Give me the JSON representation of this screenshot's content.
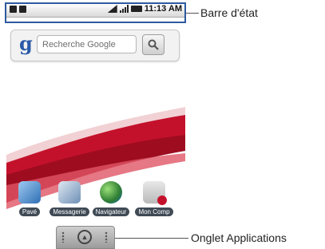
{
  "status_bar": {
    "time": "11:13 AM"
  },
  "search_widget": {
    "placeholder": "Recherche Google",
    "logo": "g"
  },
  "dock": {
    "apps": [
      {
        "label": "Pavé",
        "icon": "phone-icon"
      },
      {
        "label": "Messagerie",
        "icon": "mail-icon"
      },
      {
        "label": "Navigateur",
        "icon": "globe-icon"
      },
      {
        "label": "Mon Comp",
        "icon": "contact-icon"
      }
    ]
  },
  "callouts": {
    "status_bar": "Barre d'état",
    "applications_tab": "Onglet Applications"
  },
  "colors": {
    "callout_box": "#2d5a9e",
    "ribbon_red": "#c4112b",
    "label_bg": "#3f4a55"
  }
}
